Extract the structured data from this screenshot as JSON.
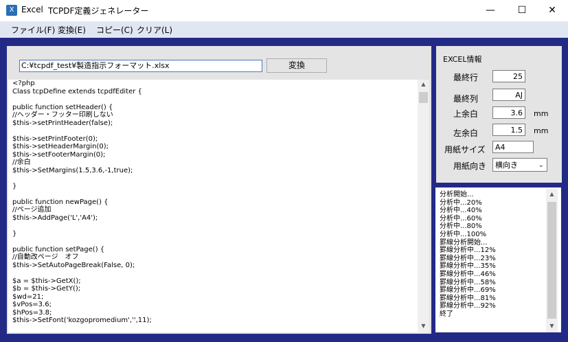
{
  "window": {
    "app_name": "Excel",
    "title": "TCPDF定義ジェネレーター",
    "minimize_glyph": "—",
    "maximize_glyph": "☐",
    "close_glyph": "✕",
    "icon": "excel-app-icon"
  },
  "menu": [
    {
      "label": "ファイル(F)"
    },
    {
      "label": "変換(E)"
    },
    {
      "label": "コピー(C)"
    },
    {
      "label": "クリア(L)"
    }
  ],
  "main": {
    "path_value": "C:¥tcpdf_test¥製造指示フォーマット.xlsx",
    "convert_label": "変換",
    "code_lines": [
      "<?php",
      "Class tcpDefine extends tcpdfEditer {",
      "",
      "public function setHeader() {",
      "//ヘッダー・フッター印刷しない",
      "$this->setPrintHeader(false);",
      "",
      "$this->setPrintFooter(0);",
      "$this->setHeaderMargin(0);",
      "$this->setFooterMargin(0);",
      "//余白",
      "$this->SetMargins(1.5,3.6,-1,true);",
      "",
      "}",
      "",
      "public function newPage() {",
      "//ページ追加",
      "$this->AddPage('L','A4');",
      "",
      "}",
      "",
      "public function setPage() {",
      "//自動改ページ　オフ",
      "$this->SetAutoPageBreak(False, 0);",
      "",
      "$a = $this->GetX();",
      "$b = $this->GetY();",
      "$wd=21;",
      "$vPos=3.6;",
      "$hPos=3.8;",
      "$this->SetFont('kozgopromedium','',11);"
    ]
  },
  "excel_info": {
    "title": "EXCEL情報",
    "last_row_label": "最終行",
    "last_row_value": "25",
    "last_col_label": "最終列",
    "last_col_value": "AJ",
    "top_margin_label": "上余白",
    "top_margin_value": "3.6",
    "left_margin_label": "左余白",
    "left_margin_value": "1.5",
    "unit_mm": "mm",
    "paper_size_label": "用紙サイズ",
    "paper_size_value": "A4",
    "orientation_label": "用紙向き",
    "orientation_value": "横向き"
  },
  "log": {
    "lines": [
      "分析開始...",
      "分析中...20%",
      "分析中...40%",
      "分析中...60%",
      "分析中...80%",
      "分析中...100%",
      "罫線分析開始...",
      "罫線分析中...12%",
      "罫線分析中...23%",
      "罫線分析中...35%",
      "罫線分析中...46%",
      "罫線分析中...58%",
      "罫線分析中...69%",
      "罫線分析中...81%",
      "罫線分析中...92%",
      "終了"
    ]
  },
  "colors": {
    "frame": "#232a86",
    "menubar": "#e1e7f2",
    "panel": "#e4e4e4",
    "input_border": "#4a76c7"
  }
}
